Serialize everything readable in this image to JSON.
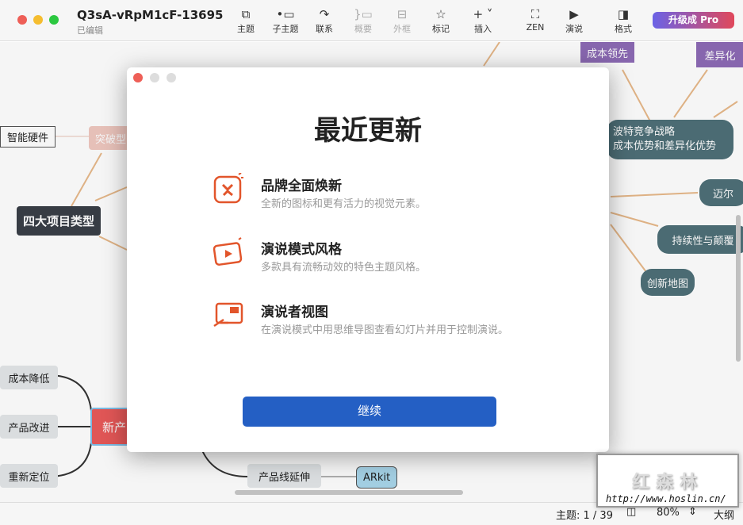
{
  "window": {
    "title": "Q3sA-vRpM1cF-13695",
    "subtitle": "已编辑"
  },
  "toolbar": {
    "items": [
      {
        "label": "主题",
        "icon": "topic-icon"
      },
      {
        "label": "子主题",
        "icon": "subtopic-icon"
      },
      {
        "label": "联系",
        "icon": "relationship-icon"
      },
      {
        "label": "概要",
        "icon": "summary-icon",
        "disabled": true
      },
      {
        "label": "外框",
        "icon": "boundary-icon",
        "disabled": true
      },
      {
        "label": "标记",
        "icon": "star-icon"
      },
      {
        "label": "插入",
        "icon": "plus-icon"
      },
      {
        "label": "ZEN",
        "icon": "fullscreen-icon"
      },
      {
        "label": "演说",
        "icon": "play-icon"
      },
      {
        "label": "格式",
        "icon": "format-panel-icon"
      }
    ],
    "pro_label": "升级成 Pro"
  },
  "canvas": {
    "nodes": {
      "smart_hw": "智能硬件",
      "breakthrough": "突破型",
      "four_types": "四大项目类型",
      "cost_leader": "成本领先",
      "diff": "差异化",
      "porter": "波特竞争战略\n成本优势和差异化优势",
      "mai": "迈尔",
      "sustain": "持续性与颠覆",
      "innovation_map": "创新地图",
      "cost_down": "成本降低",
      "improve": "产品改进",
      "reposition": "重新定位",
      "new_product": "新产",
      "line_ext": "产品线延伸",
      "arkit": "ARkit"
    }
  },
  "dialog": {
    "title": "最近更新",
    "features": [
      {
        "title": "品牌全面焕新",
        "desc": "全新的图标和更有活力的视觉元素。",
        "icon": "brand-icon"
      },
      {
        "title": "演说模式风格",
        "desc": "多款具有流畅动效的特色主题风格。",
        "icon": "pitch-style-icon"
      },
      {
        "title": "演说者视图",
        "desc": "在演说模式中用思维导图查看幻灯片并用于控制演说。",
        "icon": "presenter-view-icon"
      }
    ],
    "continue_label": "继续"
  },
  "status": {
    "topic_count": "主题: 1 / 39",
    "zoom": "80%",
    "outline": "大纲"
  },
  "watermark": {
    "text": "红森林",
    "url": "http://www.hoslin.cn/"
  },
  "colors": {
    "accent": "#245fc4",
    "icon": "#e2552b"
  }
}
